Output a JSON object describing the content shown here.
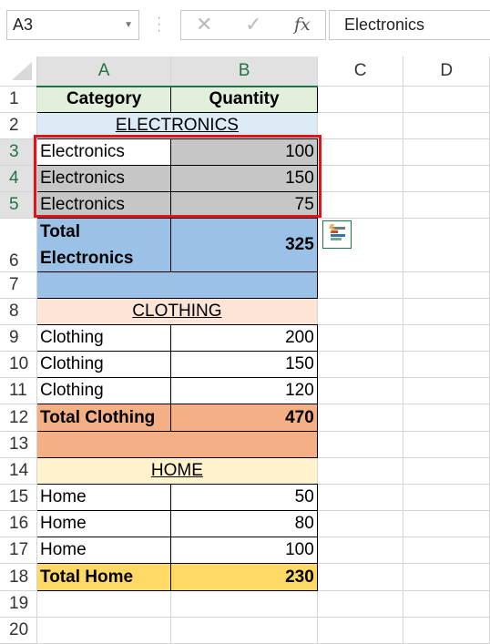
{
  "name_box": {
    "value": "A3"
  },
  "formula_bar": {
    "value": "Electronics",
    "cancel_icon": "x-icon",
    "enter_icon": "check-icon",
    "fx_label": "fx"
  },
  "columns": [
    "A",
    "B",
    "C",
    "D"
  ],
  "selected_columns": [
    "A",
    "B"
  ],
  "colors": {
    "header": "#e2efda",
    "electronics": "#ddebf7",
    "electronics_total": "#9bc2e6",
    "clothing": "#fce4d6",
    "clothing_total": "#f4b084",
    "home": "#fff2cc",
    "home_total": "#ffd966",
    "selection": "#c6c6c6",
    "selection_border": "#e3121b"
  },
  "rows": [
    {
      "num": "1",
      "a": "Category",
      "b": "Quantity",
      "style": "header"
    },
    {
      "num": "2",
      "a": "ELECTRONICS",
      "style": "section",
      "color": "electronics"
    },
    {
      "num": "3",
      "a": "Electronics",
      "b": "100",
      "style": "data",
      "selected": true,
      "active": true
    },
    {
      "num": "4",
      "a": "Electronics",
      "b": "150",
      "style": "data",
      "selected": true
    },
    {
      "num": "5",
      "a": "Electronics",
      "b": "75",
      "style": "data",
      "selected": true
    },
    {
      "num": "6",
      "a": "Total Electronics",
      "b": "325",
      "style": "total",
      "color": "electronics_total",
      "tall": true
    },
    {
      "num": "7",
      "style": "band",
      "color": "electronics_total"
    },
    {
      "num": "8",
      "a": "CLOTHING",
      "style": "section",
      "color": "clothing"
    },
    {
      "num": "9",
      "a": "Clothing",
      "b": "200",
      "style": "data"
    },
    {
      "num": "10",
      "a": "Clothing",
      "b": "150",
      "style": "data"
    },
    {
      "num": "11",
      "a": "Clothing",
      "b": "120",
      "style": "data"
    },
    {
      "num": "12",
      "a": "Total Clothing",
      "b": "470",
      "style": "total",
      "color": "clothing_total"
    },
    {
      "num": "13",
      "style": "band",
      "color": "clothing_total"
    },
    {
      "num": "14",
      "a": "HOME",
      "style": "section",
      "color": "home"
    },
    {
      "num": "15",
      "a": "Home",
      "b": "50",
      "style": "data"
    },
    {
      "num": "16",
      "a": "Home",
      "b": "80",
      "style": "data"
    },
    {
      "num": "17",
      "a": "Home",
      "b": "100",
      "style": "data"
    },
    {
      "num": "18",
      "a": "Total Home",
      "b": "230",
      "style": "total",
      "color": "home_total"
    },
    {
      "num": "19",
      "style": "empty"
    },
    {
      "num": "20",
      "style": "empty"
    }
  ],
  "quick_analysis": {
    "icon": "quick-analysis-icon"
  }
}
